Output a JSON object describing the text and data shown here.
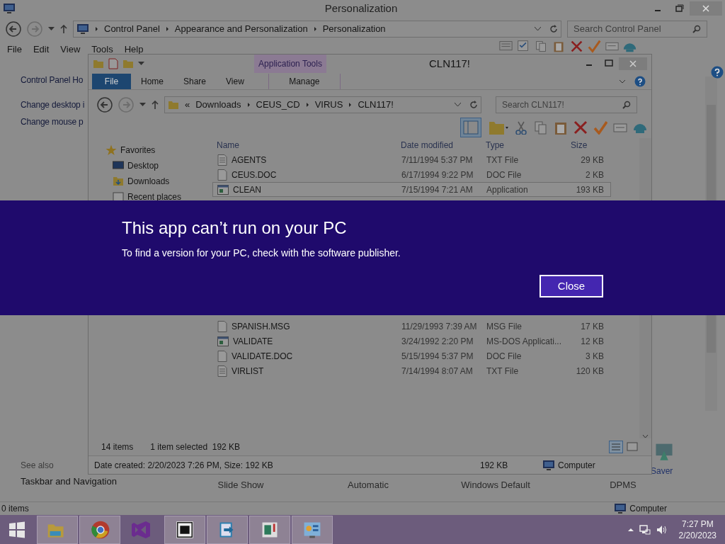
{
  "control_panel": {
    "title": "Personalization",
    "breadcrumb": [
      "Control Panel",
      "Appearance and Personalization",
      "Personalization"
    ],
    "search": {
      "placeholder": "Search Control Panel"
    },
    "menu": [
      "File",
      "Edit",
      "View",
      "Tools",
      "Help"
    ],
    "sidebar": {
      "links": [
        "Control Panel Ho",
        "Change desktop i",
        "Change mouse p"
      ],
      "see_also": "See also",
      "see_also_links": [
        "Taskbar and Navigation"
      ]
    },
    "settings_row": [
      "Slide Show",
      "Automatic",
      "Windows Default",
      "DPMS"
    ],
    "screen_saver_label": "Saver",
    "status_bar": {
      "items": "0 items",
      "location": "Computer"
    }
  },
  "explorer": {
    "title": "CLN117!",
    "contextual_tab": "Application Tools",
    "tabs": [
      {
        "label": "File",
        "kind": "file"
      },
      {
        "label": "Home",
        "kind": "tab"
      },
      {
        "label": "Share",
        "kind": "tab"
      },
      {
        "label": "View",
        "kind": "tab"
      },
      {
        "label": "Manage",
        "kind": "tab"
      }
    ],
    "address": {
      "prefix": "«",
      "path": [
        "Downloads",
        "CEUS_CD",
        "VIRUS",
        "CLN117!"
      ]
    },
    "search": {
      "placeholder": "Search CLN117!"
    },
    "nav": {
      "heading": "Favorites",
      "items": [
        "Desktop",
        "Downloads",
        "Recent places"
      ]
    },
    "columns": [
      "Name",
      "Date modified",
      "Type",
      "Size"
    ],
    "rows_top": [
      {
        "name": "AGENTS",
        "date": "7/11/1994 5:37 PM",
        "type": "TXT File",
        "size": "29 KB",
        "kind": "text",
        "selected": false
      },
      {
        "name": "CEUS.DOC",
        "date": "6/17/1994 9:22 PM",
        "type": "DOC File",
        "size": "2 KB",
        "kind": "doc",
        "selected": false
      },
      {
        "name": "CLEAN",
        "date": "7/15/1994 7:21 AM",
        "type": "Application",
        "size": "193 KB",
        "kind": "app",
        "selected": true
      }
    ],
    "rows_bottom": [
      {
        "name": "SPANISH.MSG",
        "date": "11/29/1993 7:39 AM",
        "type": "MSG File",
        "size": "17 KB",
        "kind": "doc",
        "selected": false
      },
      {
        "name": "VALIDATE",
        "date": "3/24/1992 2:20 PM",
        "type": "MS-DOS Applicati...",
        "size": "12 KB",
        "kind": "app",
        "selected": false
      },
      {
        "name": "VALIDATE.DOC",
        "date": "5/15/1994 5:37 PM",
        "type": "DOC File",
        "size": "3 KB",
        "kind": "doc",
        "selected": false
      },
      {
        "name": "VIRLIST",
        "date": "7/14/1994 8:07 AM",
        "type": "TXT File",
        "size": "120 KB",
        "kind": "text",
        "selected": false
      }
    ],
    "status": {
      "count": "14 items",
      "selection": "1 item selected  192 KB"
    },
    "details": {
      "info": "Date created: 2/20/2023 7:26 PM, Size: 192 KB",
      "size": "192 KB",
      "location": "Computer"
    }
  },
  "dialog": {
    "title": "This app can’t run on your PC",
    "message": "To find a version for your PC, check with the software publisher.",
    "button": "Close"
  },
  "taskbar": {
    "time": "7:27 PM",
    "date": "2/20/2023"
  }
}
